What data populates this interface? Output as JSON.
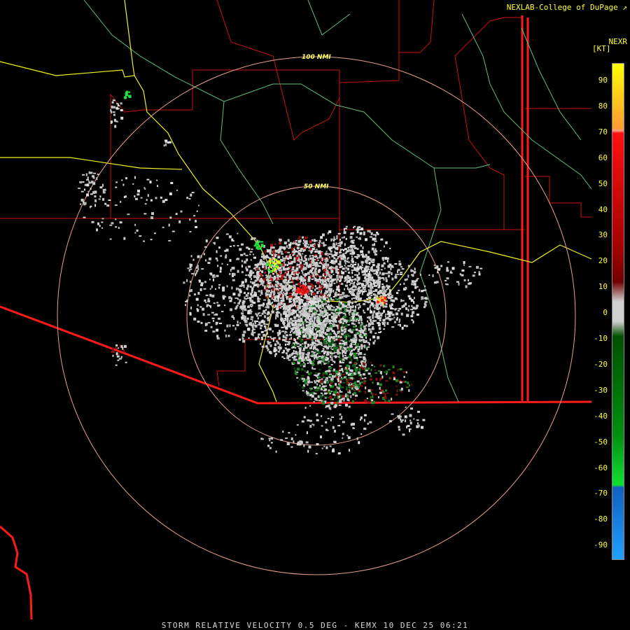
{
  "credit": "NEXLAB-College of DuPage",
  "product_code": "NEXR",
  "units": "[KT]",
  "footer": "STORM RELATIVE VELOCITY 0.5 DEG - KEMX 10 DEC 25 06:21",
  "rings": [
    {
      "label": "50 NMI"
    },
    {
      "label": "100 NMI"
    }
  ],
  "legend": {
    "ticks": [
      "90",
      "80",
      "70",
      "60",
      "50",
      "40",
      "30",
      "20",
      "10",
      "0",
      "-10",
      "-20",
      "-30",
      "-40",
      "-50",
      "-60",
      "-70",
      "-80",
      "-90"
    ],
    "colors": {
      "top": "#ffff00",
      "orange": "#ff9a40",
      "red": "#ff1010",
      "darkred": "#700000",
      "zero": "#d0d0d0",
      "darkgreen": "#005000",
      "green": "#10e030",
      "blue": "#1060c0",
      "lightblue": "#20a0ff"
    }
  },
  "map_colors": {
    "county": "#cc1111",
    "state": "#ff2222",
    "highway": "#f0f020",
    "river": "#66cc88",
    "ring": "#e8a090"
  }
}
